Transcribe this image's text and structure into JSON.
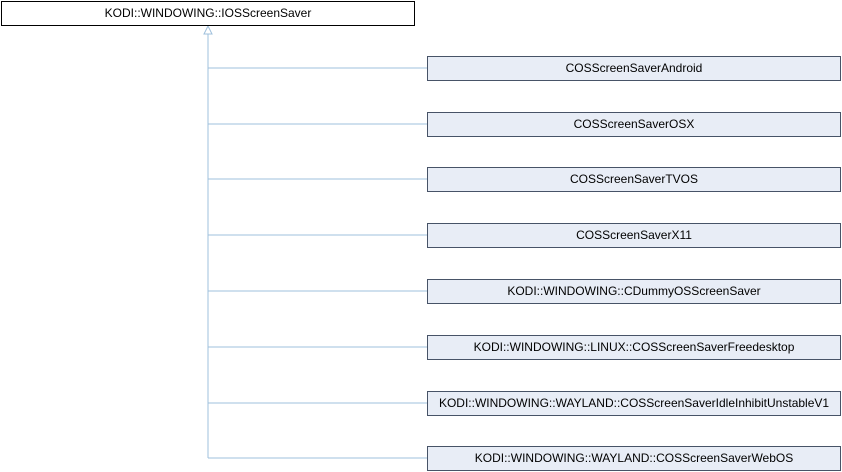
{
  "base_class": {
    "label": "KODI::WINDOWING::IOSScreenSaver"
  },
  "derived_classes": [
    {
      "label": "COSScreenSaverAndroid"
    },
    {
      "label": "COSScreenSaverOSX"
    },
    {
      "label": "COSScreenSaverTVOS"
    },
    {
      "label": "COSScreenSaverX11"
    },
    {
      "label": "KODI::WINDOWING::CDummyOSScreenSaver"
    },
    {
      "label": "KODI::WINDOWING::LINUX::COSScreenSaverFreedesktop"
    },
    {
      "label": "KODI::WINDOWING::WAYLAND::COSScreenSaverIdleInhibitUnstableV1"
    },
    {
      "label": "KODI::WINDOWING::WAYLAND::COSScreenSaverWebOS"
    }
  ],
  "colors": {
    "connector": "#9fc0dc",
    "derived_fill": "#e8edf6",
    "derived_border": "#475367",
    "base_fill": "#ffffff",
    "base_border": "#000000"
  }
}
